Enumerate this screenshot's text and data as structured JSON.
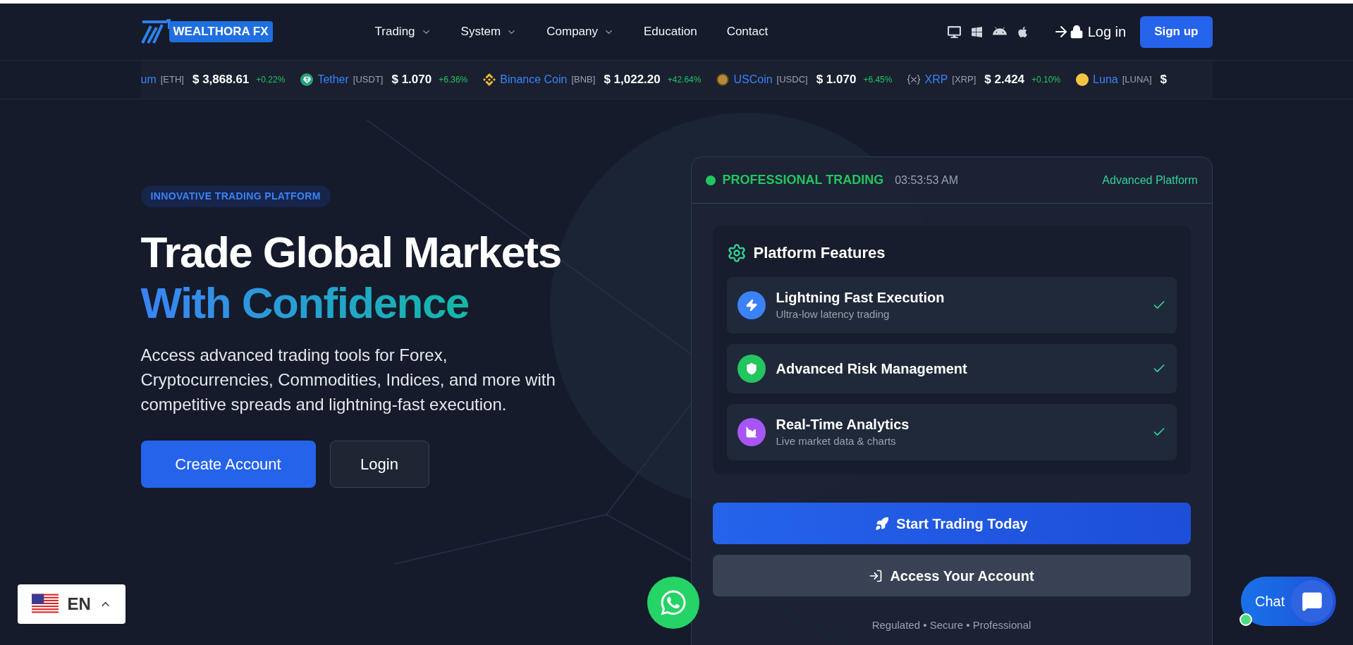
{
  "header": {
    "logo": "WEALTHORA FX",
    "nav": [
      {
        "label": "Trading",
        "dropdown": true
      },
      {
        "label": "System",
        "dropdown": true
      },
      {
        "label": "Company",
        "dropdown": true
      },
      {
        "label": "Education",
        "dropdown": false
      },
      {
        "label": "Contact",
        "dropdown": false
      }
    ],
    "login": "Log in",
    "signup": "Sign up"
  },
  "ticker": [
    {
      "name": "um",
      "symbol": "[ETH]",
      "price": "$ 3,868.61",
      "change": "+0.22%"
    },
    {
      "name": "Tether",
      "symbol": "[USDT]",
      "price": "$ 1.070",
      "change": "+6.36%"
    },
    {
      "name": "Binance Coin",
      "symbol": "[BNB]",
      "price": "$ 1,022.20",
      "change": "+42.64%"
    },
    {
      "name": "USCoin",
      "symbol": "[USDC]",
      "price": "$ 1.070",
      "change": "+6.45%"
    },
    {
      "name": "XRP",
      "symbol": "[XRP]",
      "price": "$ 2.424",
      "change": "+0.10%"
    },
    {
      "name": "Luna",
      "symbol": "[LUNA]",
      "price": "$"
    }
  ],
  "hero": {
    "badge": "INNOVATIVE TRADING PLATFORM",
    "title_line1": "Trade Global Markets",
    "title_line2": "With Confidence",
    "description": "Access advanced trading tools for Forex, Cryptocurrencies, Commodities, Indices, and more with competitive spreads and lightning-fast execution.",
    "buttons": [
      "Create Account",
      "Login"
    ]
  },
  "card": {
    "status": "PROFESSIONAL TRADING",
    "time": "03:53:53 AM",
    "tag": "Advanced Platform",
    "features_title": "Platform Features",
    "features": [
      {
        "title": "Lightning Fast Execution",
        "subtitle": "Ultra-low latency trading",
        "color": "#3b82f6",
        "checked": true
      },
      {
        "title": "Advanced Risk Management",
        "color": "#22c55e",
        "checked": true
      },
      {
        "title": "Real-Time Analytics",
        "subtitle": "Live market data & charts",
        "color": "#a855f7",
        "checked": true
      }
    ],
    "primary_button": "Start Trading Today",
    "secondary_button": "Access Your Account",
    "footer": "Regulated • Secure • Professional"
  },
  "language": {
    "code": "EN"
  },
  "chat": {
    "label": "Chat",
    "online": true
  }
}
